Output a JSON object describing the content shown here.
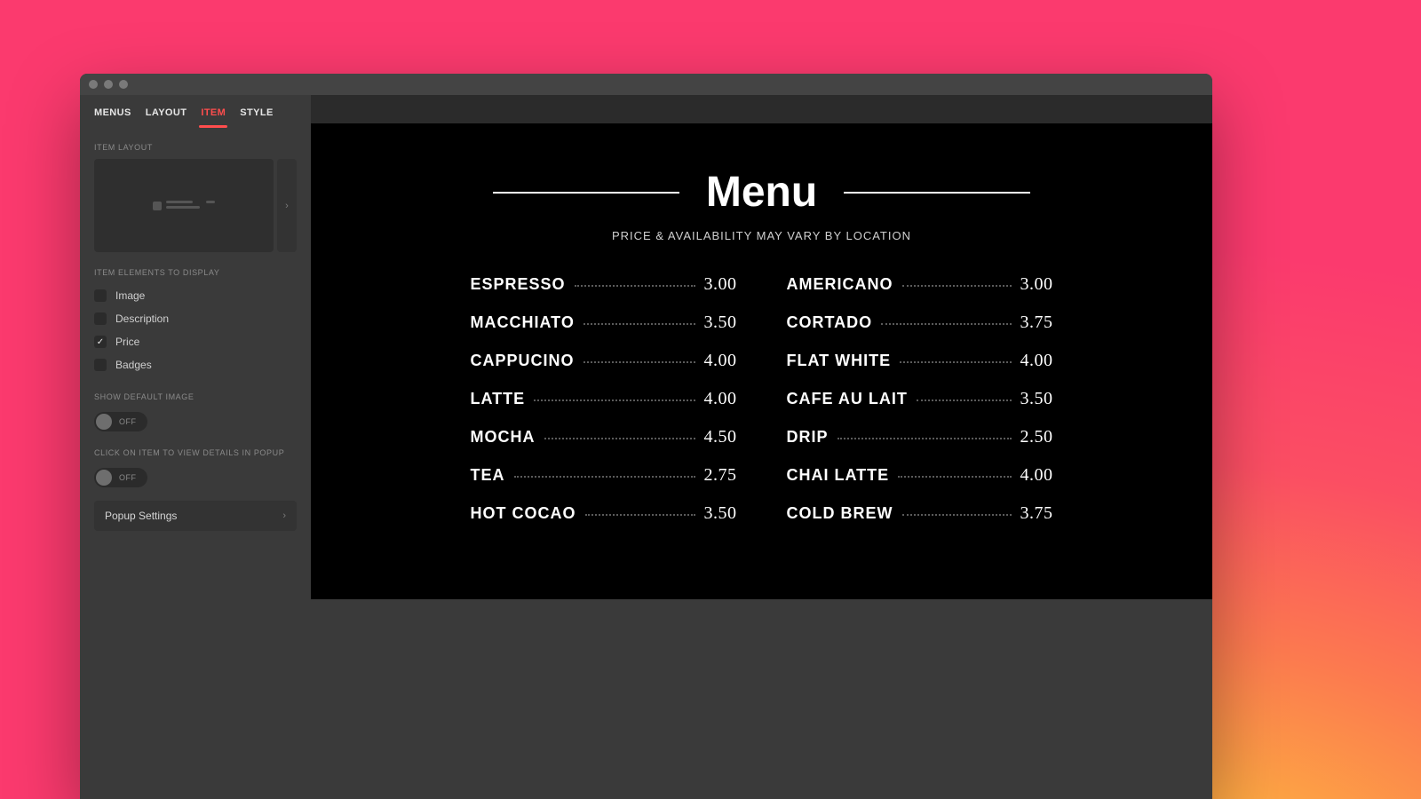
{
  "tabs": [
    "MENUS",
    "LAYOUT",
    "ITEM",
    "STYLE"
  ],
  "active_tab_index": 2,
  "sections": {
    "item_layout": "ITEM LAYOUT",
    "elements": "ITEM ELEMENTS TO DISPLAY",
    "default_image": "SHOW DEFAULT IMAGE",
    "popup": "CLICK ON ITEM TO VIEW DETAILS IN POPUP"
  },
  "element_toggles": [
    {
      "label": "Image",
      "checked": false
    },
    {
      "label": "Description",
      "checked": false
    },
    {
      "label": "Price",
      "checked": true
    },
    {
      "label": "Badges",
      "checked": false
    }
  ],
  "toggles": {
    "default_image": {
      "state": "OFF"
    },
    "popup": {
      "state": "OFF"
    }
  },
  "settings_row": {
    "label": "Popup Settings"
  },
  "menu": {
    "title": "Menu",
    "subtitle": "PRICE & AVAILABILITY MAY VARY BY LOCATION",
    "columns": [
      [
        {
          "name": "ESPRESSO",
          "price": "3.00"
        },
        {
          "name": "MACCHIATO",
          "price": "3.50"
        },
        {
          "name": "CAPPUCINO",
          "price": "4.00"
        },
        {
          "name": "LATTE",
          "price": "4.00"
        },
        {
          "name": "MOCHA",
          "price": "4.50"
        },
        {
          "name": "TEA",
          "price": "2.75"
        },
        {
          "name": "HOT COCAO",
          "price": "3.50"
        }
      ],
      [
        {
          "name": "AMERICANO",
          "price": "3.00"
        },
        {
          "name": "CORTADO",
          "price": "3.75"
        },
        {
          "name": "FLAT WHITE",
          "price": "4.00"
        },
        {
          "name": "CAFE AU LAIT",
          "price": "3.50"
        },
        {
          "name": "DRIP",
          "price": "2.50"
        },
        {
          "name": "CHAI LATTE",
          "price": "4.00"
        },
        {
          "name": "COLD BREW",
          "price": "3.75"
        }
      ]
    ]
  }
}
